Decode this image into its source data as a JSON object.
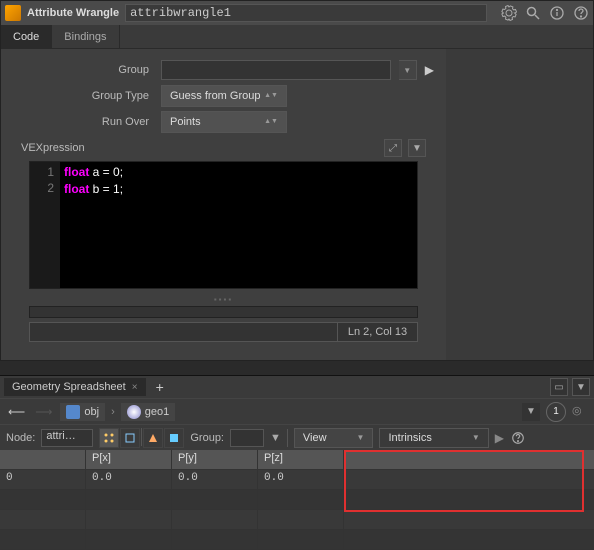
{
  "header": {
    "node_type": "Attribute Wrangle",
    "node_name": "attribwrangle1"
  },
  "tabs": [
    {
      "label": "Code",
      "active": true
    },
    {
      "label": "Bindings",
      "active": false
    }
  ],
  "params": {
    "group_label": "Group",
    "group_value": "",
    "group_type_label": "Group Type",
    "group_type_value": "Guess from Group",
    "run_over_label": "Run Over",
    "run_over_value": "Points"
  },
  "vex": {
    "label": "VEXpression",
    "lines": [
      {
        "n": "1",
        "kw": "float",
        "rest": " a = 0;"
      },
      {
        "n": "2",
        "kw": "float",
        "rest": " b = 1;"
      }
    ],
    "status": "Ln 2, Col 13"
  },
  "spreadsheet": {
    "tab_label": "Geometry Spreadsheet",
    "path": {
      "obj": "obj",
      "geo": "geo1"
    },
    "circle": "1",
    "node_label": "Node:",
    "node_value": "attri…",
    "group_label": "Group:",
    "view_label": "View",
    "intrinsics_label": "Intrinsics",
    "columns": {
      "idx": "",
      "px": "P[x]",
      "py": "P[y]",
      "pz": "P[z]"
    },
    "rows": [
      {
        "idx": "0",
        "px": "0.0",
        "py": "0.0",
        "pz": "0.0"
      }
    ]
  }
}
